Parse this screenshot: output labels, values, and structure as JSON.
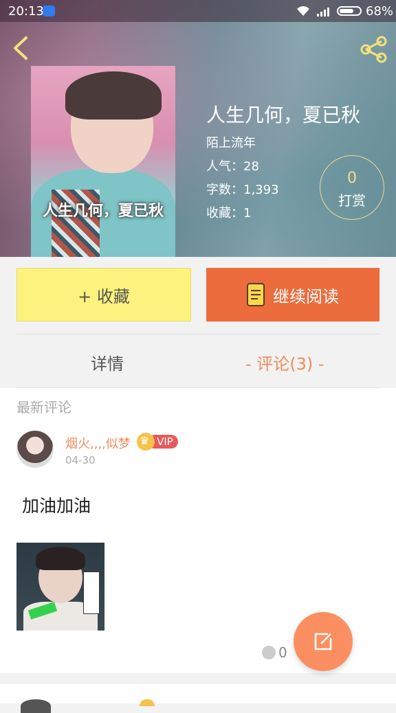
{
  "status_bar": {
    "time": "20:13",
    "battery": "68%"
  },
  "icons": {
    "back": "chevron-left-icon",
    "share": "share-icon",
    "book": "book-icon",
    "edit": "edit-icon",
    "comment": "comment-bubble-icon",
    "crown": "crown-icon"
  },
  "colors": {
    "accent_orange": "#ec6c3d",
    "collect_yellow": "#fdf27d",
    "active_tab": "#ef8c5e",
    "vip_red": "#e9595b",
    "fab": "#fb8f62"
  },
  "book": {
    "cover_title": "人生几何，夏已秋",
    "title": "人生几何，夏已秋",
    "author": "陌上流年",
    "popularity": "人气：28",
    "word_count": "字数：1,393",
    "favorites": "收藏：1"
  },
  "reward": {
    "count": "0",
    "label": "打赏"
  },
  "actions": {
    "collect_label": "+ 收藏",
    "read_label": "继续阅读"
  },
  "tabs": {
    "detail": "详情",
    "comments": "- 评论(3) -"
  },
  "comments_section": {
    "label": "最新评论",
    "items": [
      {
        "username": "烟火,,,,似梦",
        "badge": "VIP",
        "date": "04-30",
        "text": "加油加油",
        "reply_count": "0"
      }
    ]
  }
}
